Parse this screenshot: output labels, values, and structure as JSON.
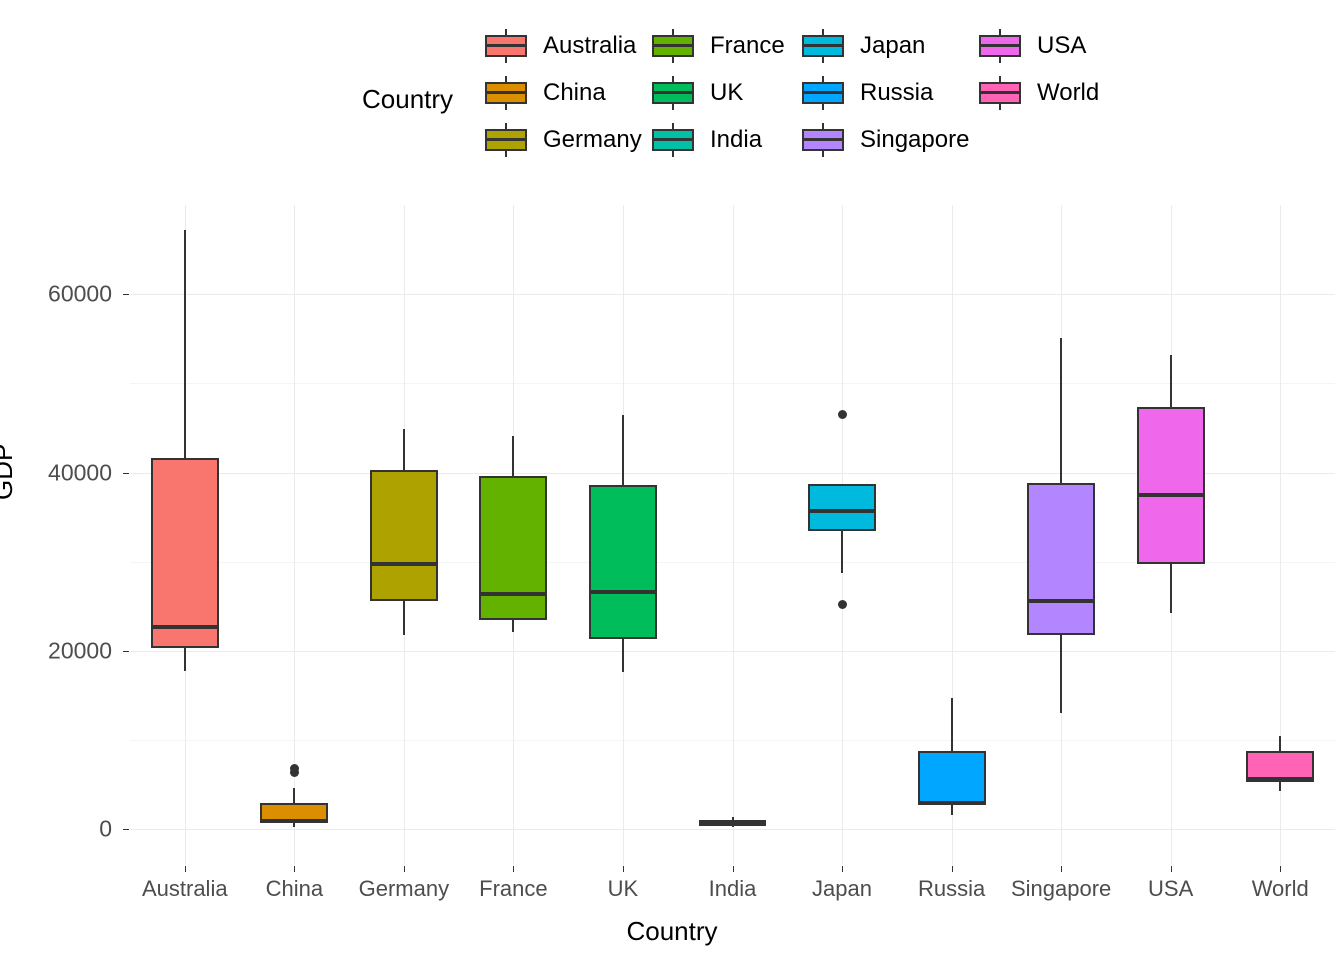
{
  "legend": {
    "title": "Country",
    "columns": [
      [
        {
          "label": "Australia",
          "color": "#F8766D"
        },
        {
          "label": "China",
          "color": "#DB8E00"
        },
        {
          "label": "Germany",
          "color": "#AEA200"
        }
      ],
      [
        {
          "label": "France",
          "color": "#64B200"
        },
        {
          "label": "UK",
          "color": "#00BD5C"
        },
        {
          "label": "India",
          "color": "#00C1A7"
        }
      ],
      [
        {
          "label": "Japan",
          "color": "#00BADE"
        },
        {
          "label": "Russia",
          "color": "#00A6FF"
        },
        {
          "label": "Singapore",
          "color": "#B385FF"
        }
      ],
      [
        {
          "label": "USA",
          "color": "#EF67EB"
        },
        {
          "label": "World",
          "color": "#FF63B6"
        }
      ]
    ]
  },
  "chart_data": {
    "type": "box",
    "title": "",
    "xlabel": "Country",
    "ylabel": "GDP",
    "ylim": [
      -4000,
      70000
    ],
    "yticks": [
      0,
      20000,
      40000,
      60000
    ],
    "ytick_labels": [
      "0",
      "20000",
      "40000",
      "60000"
    ],
    "yminor": [
      10000,
      30000,
      50000
    ],
    "grid": true,
    "legend_position": "top",
    "categories": [
      "Australia",
      "China",
      "Germany",
      "France",
      "UK",
      "India",
      "Japan",
      "Russia",
      "Singapore",
      "USA",
      "World"
    ],
    "boxes": [
      {
        "category": "Australia",
        "color": "#F8766D",
        "whisker_low": 17800,
        "q1": 20300,
        "median": 22700,
        "q3": 41600,
        "whisker_high": 67200,
        "outliers": []
      },
      {
        "category": "China",
        "color": "#DB8E00",
        "whisker_low": 300,
        "q1": 700,
        "median": 900,
        "q3": 3000,
        "whisker_high": 4600,
        "outliers": [
          6400,
          6800
        ]
      },
      {
        "category": "Germany",
        "color": "#AEA200",
        "whisker_low": 21800,
        "q1": 25600,
        "median": 29800,
        "q3": 40300,
        "whisker_high": 44900,
        "outliers": []
      },
      {
        "category": "France",
        "color": "#64B200",
        "whisker_low": 22100,
        "q1": 23500,
        "median": 26400,
        "q3": 39600,
        "whisker_high": 44100,
        "outliers": []
      },
      {
        "category": "UK",
        "color": "#00BD5C",
        "whisker_low": 17600,
        "q1": 21300,
        "median": 26600,
        "q3": 38600,
        "whisker_high": 46500,
        "outliers": []
      },
      {
        "category": "India",
        "color": "#00C1A7",
        "whisker_low": 300,
        "q1": 400,
        "median": 700,
        "q3": 1100,
        "whisker_high": 1400,
        "outliers": []
      },
      {
        "category": "Japan",
        "color": "#00BADE",
        "whisker_low": 28700,
        "q1": 33500,
        "median": 35700,
        "q3": 38700,
        "whisker_high": 38700,
        "outliers": [
          25200,
          46500
        ]
      },
      {
        "category": "Russia",
        "color": "#00A6FF",
        "whisker_low": 1600,
        "q1": 2700,
        "median": 3000,
        "q3": 8800,
        "whisker_high": 14700,
        "outliers": []
      },
      {
        "category": "Singapore",
        "color": "#B385FF",
        "whisker_low": 13000,
        "q1": 21800,
        "median": 25600,
        "q3": 38800,
        "whisker_high": 55100,
        "outliers": []
      },
      {
        "category": "USA",
        "color": "#EF67EB",
        "whisker_low": 24200,
        "q1": 29800,
        "median": 37500,
        "q3": 47300,
        "whisker_high": 53200,
        "outliers": []
      },
      {
        "category": "World",
        "color": "#FF63B6",
        "whisker_low": 4300,
        "q1": 5300,
        "median": 5600,
        "q3": 8800,
        "whisker_high": 10500,
        "outliers": []
      }
    ]
  }
}
